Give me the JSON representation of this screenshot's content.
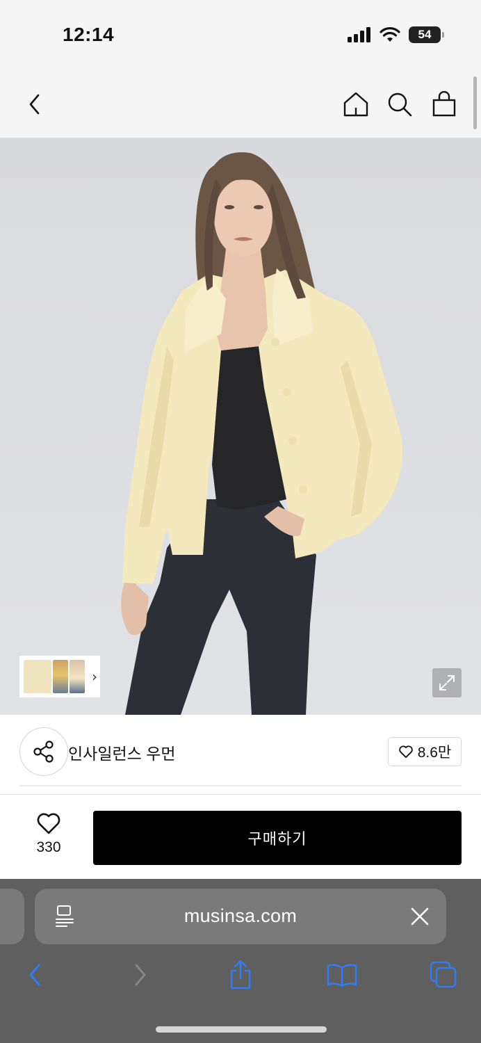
{
  "status_bar": {
    "time": "12:14",
    "battery_level": "54"
  },
  "top_nav": {
    "icons": [
      "back-icon",
      "home-icon",
      "search-icon",
      "shopping-bag-icon"
    ]
  },
  "hero": {
    "thumbnail_icon": "chevron-right-icon",
    "expand_icon": "expand-icon"
  },
  "brand": {
    "name": "인사일런스 우먼",
    "like_count": "8.6만",
    "share_icon": "share-icon"
  },
  "purchase": {
    "wish_count": "330",
    "buy_label": "구매하기"
  },
  "browser": {
    "url": "musinsa.com",
    "toolbar": [
      "back-icon",
      "forward-icon",
      "share-icon",
      "bookmarks-icon",
      "tabs-icon"
    ]
  },
  "colors": {
    "buy_button": "#000000",
    "browser_accent": "#2f7cf6",
    "browser_bar": "#5f5f5f"
  }
}
